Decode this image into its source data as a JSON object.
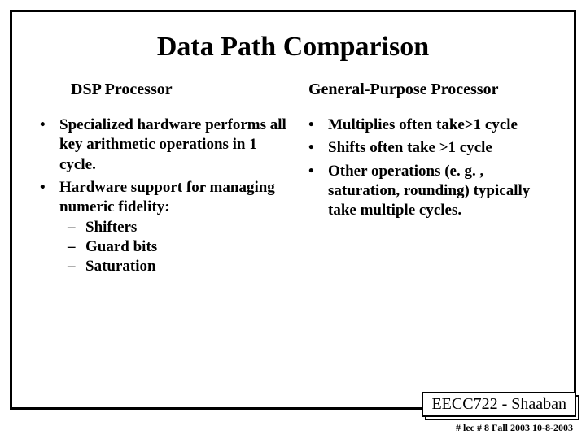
{
  "title": "Data Path Comparison",
  "left": {
    "header": "DSP Processor",
    "items": {
      "0": "Specialized hardware performs all key arithmetic operations in 1 cycle.",
      "1": "Hardware support for managing numeric fidelity:"
    },
    "sub": {
      "0": "Shifters",
      "1": "Guard bits",
      "2": "Saturation"
    }
  },
  "right": {
    "header": "General-Purpose Processor",
    "items": {
      "0": "Multiplies often take>1 cycle",
      "1": "Shifts often take >1 cycle",
      "2": "Other operations (e. g. , saturation, rounding) typically take multiple cycles."
    }
  },
  "footer": {
    "course": "EECC722 - Shaaban",
    "line": "#   lec # 8    Fall 2003    10-8-2003"
  }
}
